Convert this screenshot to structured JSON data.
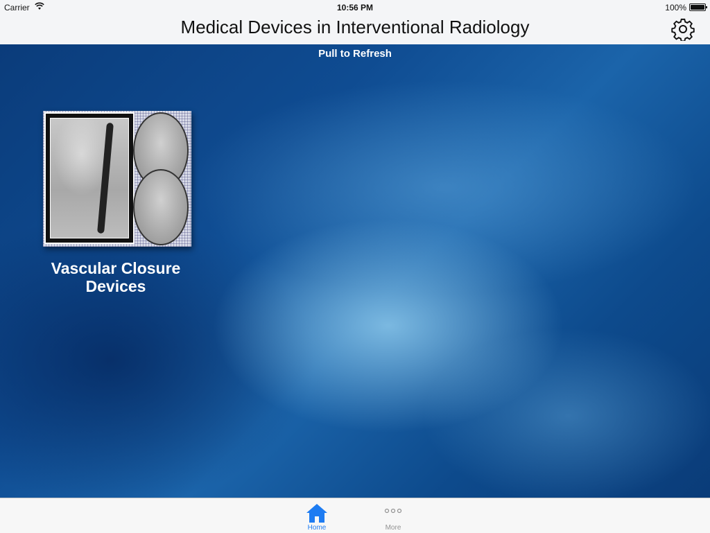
{
  "status_bar": {
    "carrier": "Carrier",
    "time": "10:56 PM",
    "battery": "100%"
  },
  "nav": {
    "title": "Medical Devices in Interventional Radiology",
    "settings_icon": "gear-icon"
  },
  "content": {
    "pull_to_refresh": "Pull to Refresh",
    "tiles": [
      {
        "label": "Vascular Closure Devices",
        "image": "angiography-xray-thumbnail"
      }
    ]
  },
  "tab_bar": {
    "tabs": [
      {
        "label": "Home",
        "icon": "home-icon",
        "selected": true
      },
      {
        "label": "More",
        "icon": "more-icon",
        "selected": false
      }
    ]
  },
  "colors": {
    "accent": "#1e7cf2",
    "background": "#0d3d78"
  }
}
